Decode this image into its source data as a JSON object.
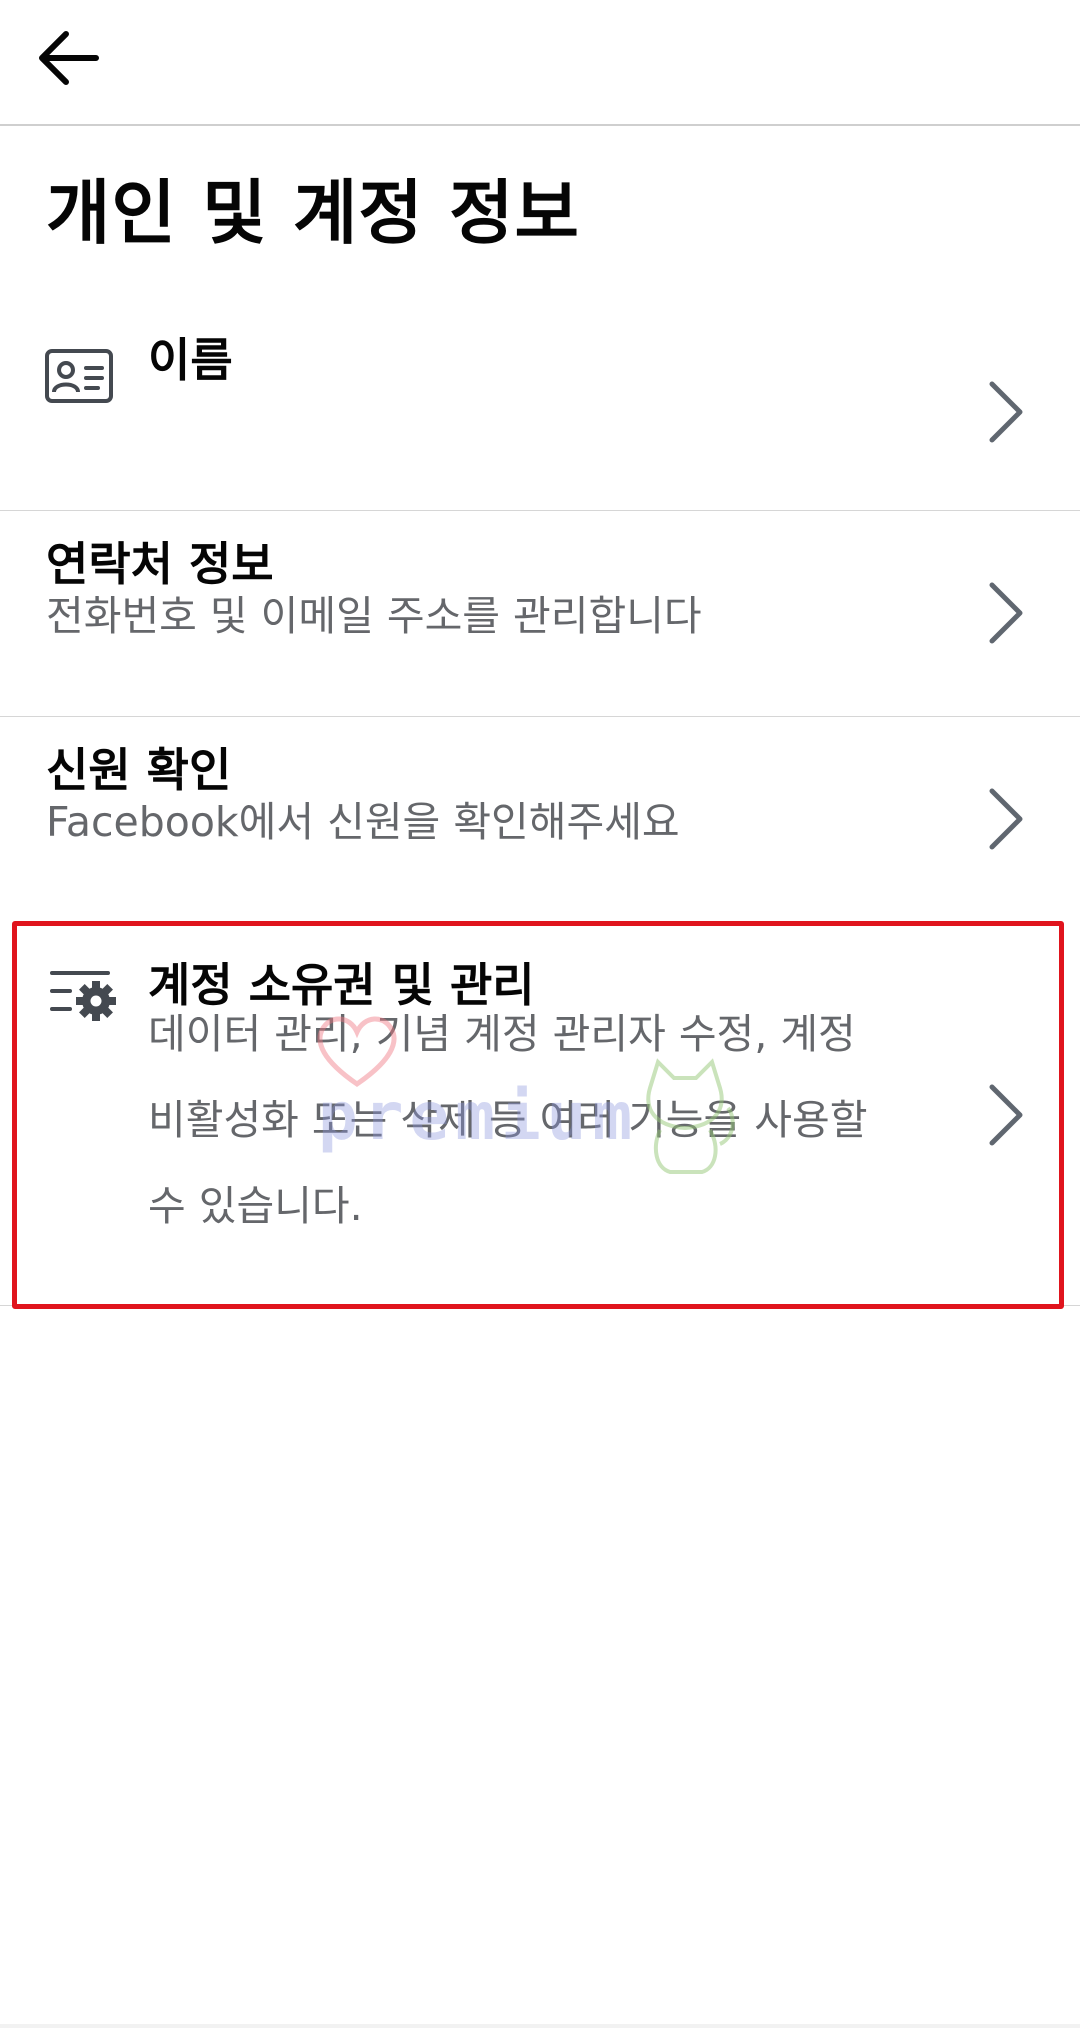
{
  "header": {
    "back_icon": "arrow-left-icon"
  },
  "page": {
    "title": "개인 및 계정 정보"
  },
  "rows": [
    {
      "id": "name",
      "icon": "id-card-icon",
      "title": "이름",
      "subtitle": ""
    },
    {
      "id": "contact",
      "title": "연락처 정보",
      "subtitle": "전화번호 및 이메일 주소를 관리합니다"
    },
    {
      "id": "identity",
      "title": "신원 확인",
      "subtitle": "Facebook에서 신원을 확인해주세요"
    },
    {
      "id": "ownership",
      "icon": "settings-list-icon",
      "title": "계정 소유권 및 관리",
      "subtitle_lines": [
        "데이터 관리, 기념 계정 관리자 수정, 계정",
        "비활성화 또는 삭제 등 여러 기능을 사용할",
        "수 있습니다."
      ]
    }
  ],
  "overlay": {
    "highlight_color": "#e0141d",
    "watermark_text": "premium"
  },
  "colors": {
    "title": "#050505",
    "subtitle": "#65676b",
    "chevron": "#606770",
    "divider": "#d6d6d6"
  }
}
